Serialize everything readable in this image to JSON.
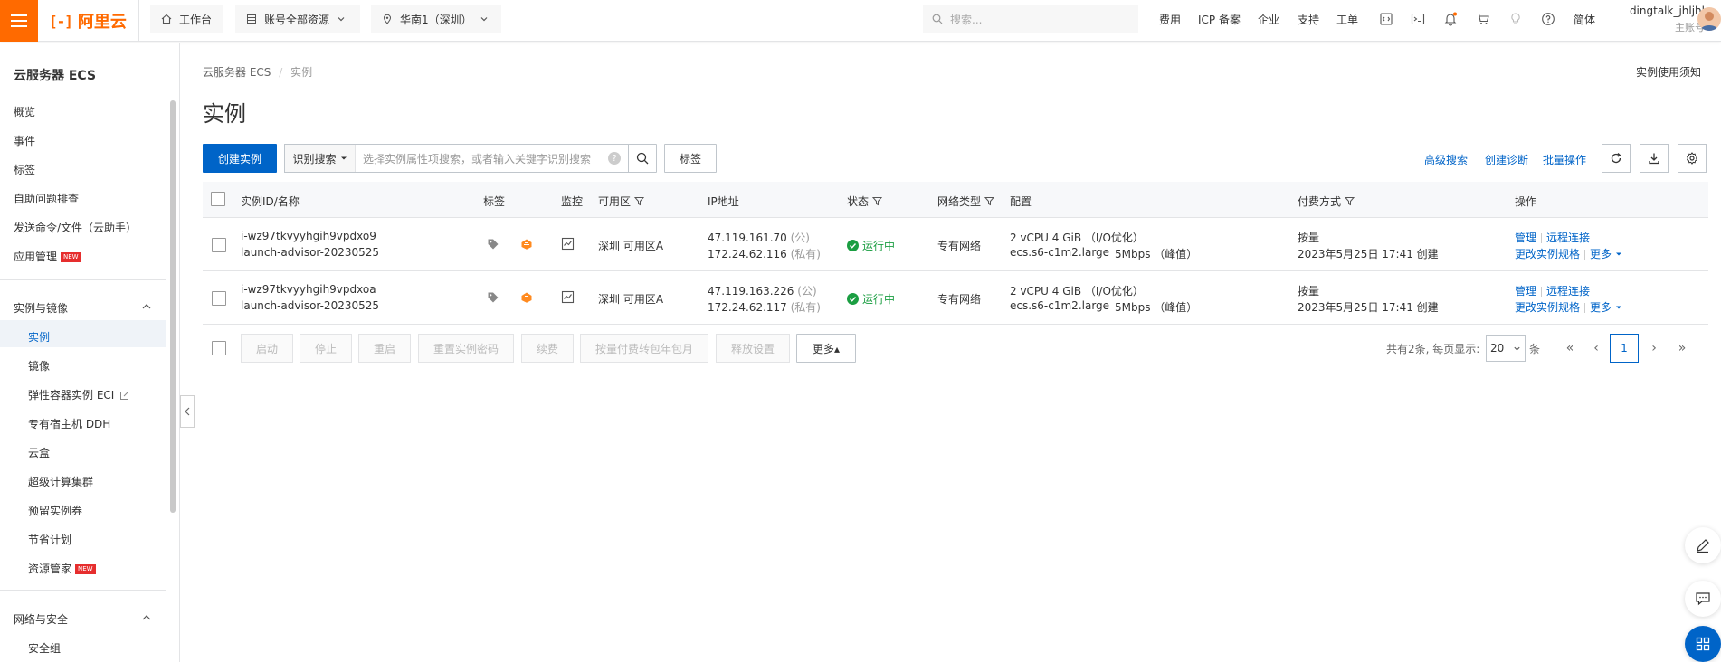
{
  "topbar": {
    "logo_text": "阿里云",
    "workspace": "工作台",
    "resource_scope": "账号全部资源",
    "region": "华南1（深圳）",
    "search_placeholder": "搜索...",
    "links": [
      "费用",
      "ICP 备案",
      "企业",
      "支持",
      "工单"
    ],
    "lang": "简体",
    "user_name": "dingtalk_jhljhl",
    "user_role": "主账号"
  },
  "sidebar": {
    "title": "云服务器 ECS",
    "top_items": [
      "概览",
      "事件",
      "标签",
      "自助问题排查",
      "发送命令/文件（云助手）",
      "应用管理"
    ],
    "new_badge": "NEW",
    "group1": "实例与镜像",
    "group1_items": [
      "实例",
      "镜像",
      "弹性容器实例 ECI",
      "专有宿主机 DDH",
      "云盒",
      "超级计算集群",
      "预留实例券",
      "节省计划",
      "资源管家"
    ],
    "group2": "网络与安全",
    "group2_items": [
      "安全组"
    ]
  },
  "main": {
    "breadcrumb": [
      "云服务器 ECS",
      "实例"
    ],
    "title": "实例",
    "notice": "实例使用须知",
    "toolbar": {
      "create": "创建实例",
      "search_type": "识别搜索",
      "search_placeholder": "选择实例属性项搜索，或者输入关键字识别搜索",
      "tag_btn": "标签",
      "advanced_search": "高级搜索",
      "create_diagnosis": "创建诊断",
      "batch_ops": "批量操作"
    },
    "columns": [
      "实例ID/名称",
      "标签",
      "监控",
      "可用区",
      "IP地址",
      "状态",
      "网络类型",
      "配置",
      "付费方式",
      "操作"
    ],
    "rows": [
      {
        "id": "i-wz97tkvyyhgih9vpdxo9",
        "name": "launch-advisor-20230525",
        "zone": "深圳 可用区A",
        "ip_public": "47.119.161.70",
        "ip_public_tag": "(公)",
        "ip_private": "172.24.62.116",
        "ip_private_tag": "(私有)",
        "status": "运行中",
        "network": "专有网络",
        "spec": "2 vCPU 4 GiB （I/O优化）",
        "type": "ecs.s6-c1m2.large",
        "bandwidth": "5Mbps （峰值）",
        "billing": "按量",
        "created": "2023年5月25日 17:41 创建",
        "op_manage": "管理",
        "op_remote": "远程连接",
        "op_change": "更改实例规格",
        "op_more": "更多"
      },
      {
        "id": "i-wz97tkvyyhgih9vpdxoa",
        "name": "launch-advisor-20230525",
        "zone": "深圳 可用区A",
        "ip_public": "47.119.163.226",
        "ip_public_tag": "(公)",
        "ip_private": "172.24.62.117",
        "ip_private_tag": "(私有)",
        "status": "运行中",
        "network": "专有网络",
        "spec": "2 vCPU 4 GiB （I/O优化）",
        "type": "ecs.s6-c1m2.large",
        "bandwidth": "5Mbps （峰值）",
        "billing": "按量",
        "created": "2023年5月25日 17:41 创建",
        "op_manage": "管理",
        "op_remote": "远程连接",
        "op_change": "更改实例规格",
        "op_more": "更多"
      }
    ],
    "footer": {
      "buttons": [
        "启动",
        "停止",
        "重启",
        "重置实例密码",
        "续费",
        "按量付费转包年包月",
        "释放设置"
      ],
      "more": "更多▴",
      "total_text": "共有2条, 每页显示:",
      "page_size": "20",
      "unit": "条",
      "current_page": "1"
    }
  },
  "colors": {
    "accent": "#0064c8",
    "brand": "#ff6a00",
    "running": "#1b9e42"
  }
}
